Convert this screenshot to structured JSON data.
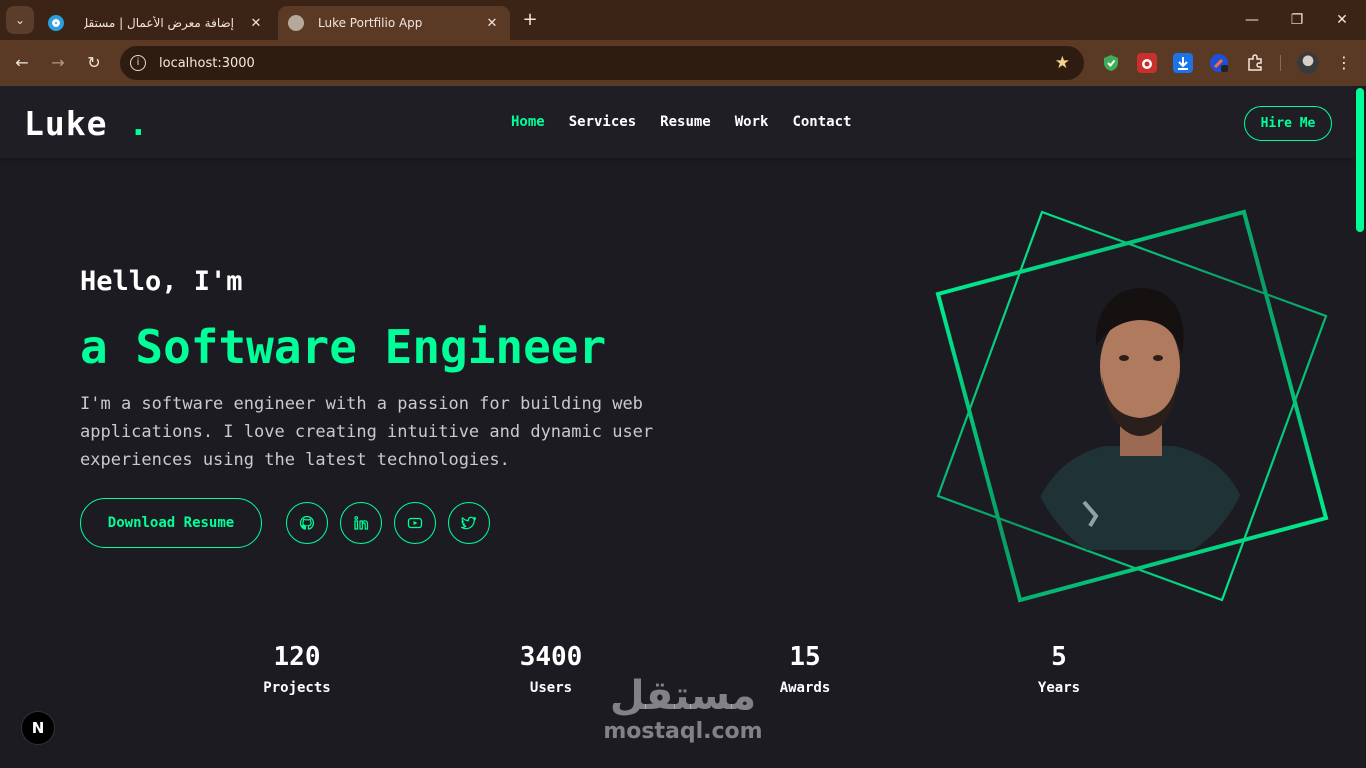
{
  "browser": {
    "tabs": [
      {
        "title": "إضافة معرض الأعمال | مستقل",
        "active": false
      },
      {
        "title": "Luke Portfilio App",
        "active": true
      }
    ],
    "url": "localhost:3000",
    "icons": {
      "tab_menu": "chevron-down-icon",
      "new_tab": "plus-icon",
      "back": "arrow-left-icon",
      "forward": "arrow-right-icon",
      "reload": "reload-icon",
      "bookmark": "star-icon",
      "more": "kebab-menu-icon"
    },
    "glyphs": {
      "chevron": "⌄",
      "close": "✕",
      "plus": "+",
      "back": "←",
      "forward": "→",
      "reload": "↻",
      "info": "i",
      "star": "★",
      "minimize": "—",
      "restore": "❐",
      "window_close": "✕",
      "menu": "⋮"
    }
  },
  "site": {
    "logo": {
      "text": "Luke",
      "dot": "."
    },
    "nav": [
      {
        "label": "Home",
        "active": true
      },
      {
        "label": "Services",
        "active": false
      },
      {
        "label": "Resume",
        "active": false
      },
      {
        "label": "Work",
        "active": false
      },
      {
        "label": "Contact",
        "active": false
      }
    ],
    "hire_label": "Hire Me",
    "hero": {
      "greeting": "Hello, I'm",
      "role": "a Software Engineer",
      "intro": "I'm a software engineer with a passion for building web applications. I love creating intuitive and dynamic user experiences using the latest technologies.",
      "download_label": "Download Resume",
      "socials": [
        "github-icon",
        "linkedin-icon",
        "youtube-icon",
        "twitter-icon"
      ]
    },
    "stats": [
      {
        "value": "120",
        "label": "Projects"
      },
      {
        "value": "3400",
        "label": "Users"
      },
      {
        "value": "15",
        "label": "Awards"
      },
      {
        "value": "5",
        "label": "Years"
      }
    ],
    "accent_color": "#00ff99",
    "background_color": "#1c1b22"
  },
  "overlay": {
    "next_badge": "N",
    "watermark_ar": "مستقل",
    "watermark_en": "mostaql.com"
  }
}
